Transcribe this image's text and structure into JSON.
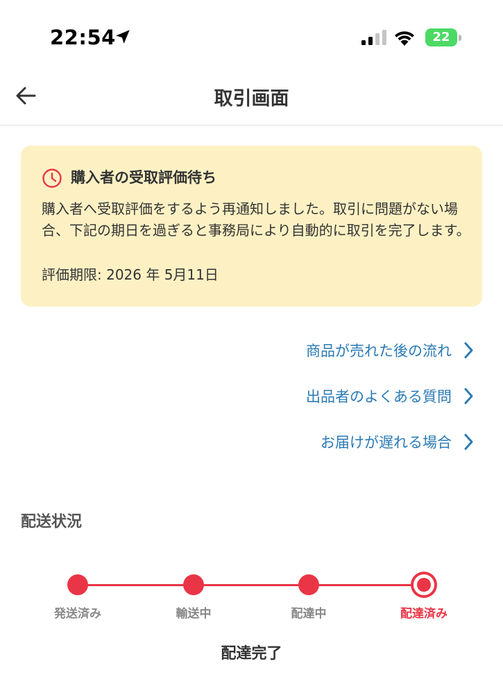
{
  "status_bar": {
    "time": "22:54",
    "battery": "22",
    "location_icon": "location-arrow-icon",
    "signal_icon": "cellular-signal-icon",
    "wifi_icon": "wifi-icon",
    "battery_icon": "battery-charging-icon"
  },
  "header": {
    "title": "取引画面",
    "back_icon": "arrow-left-icon"
  },
  "notice": {
    "icon": "clock-icon",
    "title": "購入者の受取評価待ち",
    "body": "購入者へ受取評価をするよう再通知しました。取引に問題がない場合、下記の期日を過ぎると事務局により自動的に取引を完了します。",
    "deadline": "評価期限: 2026 年 5月11日"
  },
  "links": [
    {
      "label": "商品が売れた後の流れ",
      "icon": "chevron-right-icon"
    },
    {
      "label": "出品者のよくある質問",
      "icon": "chevron-right-icon"
    },
    {
      "label": "お届けが遅れる場合",
      "icon": "chevron-right-icon"
    }
  ],
  "delivery": {
    "section_title": "配送状況",
    "steps": [
      "発送済み",
      "輸送中",
      "配達中",
      "配達済み"
    ],
    "current_step": 4,
    "status_text": "配達完了"
  },
  "colors": {
    "accent_red": "#ea3546",
    "link_blue": "#2a7ab5",
    "notice_bg": "#fdf1c4"
  }
}
